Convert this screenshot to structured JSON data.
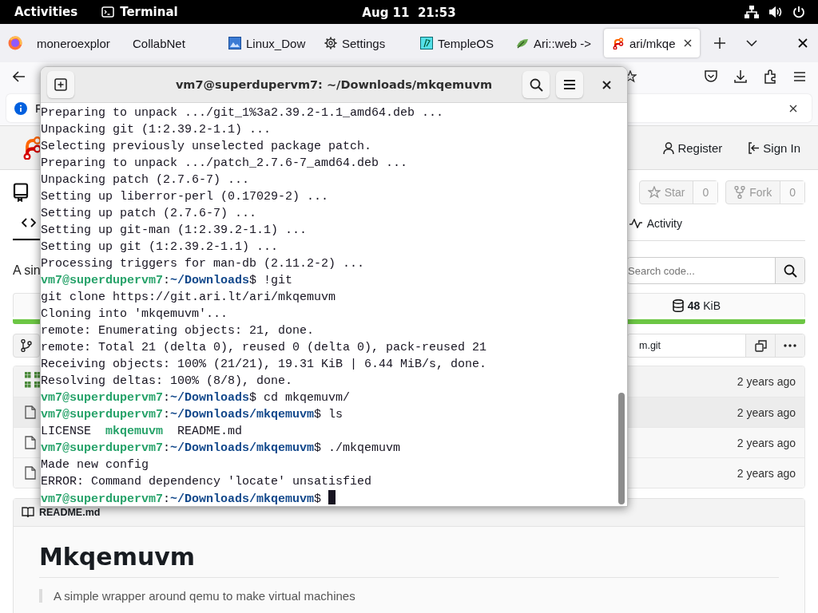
{
  "top_bar": {
    "activities": "Activities",
    "app": "Terminal",
    "clock": "Aug 11  21:53"
  },
  "browser": {
    "tabs": [
      {
        "label": "moneroexplor",
        "kind": "plain",
        "selected": false
      },
      {
        "label": "CollabNet",
        "kind": "plain",
        "selected": false
      },
      {
        "label": "Linux_Dow",
        "kind": "image",
        "selected": false
      },
      {
        "label": "Settings",
        "kind": "gear",
        "selected": false
      },
      {
        "label": "TempleOS",
        "kind": "page",
        "selected": false
      },
      {
        "label": "Ari::web ->",
        "kind": "leaf",
        "selected": false
      },
      {
        "label": "ari/mkqe",
        "kind": "forge",
        "selected": true
      }
    ],
    "info_bar": {
      "text": "F"
    }
  },
  "site_header": {
    "register": "Register",
    "sign_in": "Sign In"
  },
  "repo": {
    "star": "Star",
    "star_count": "0",
    "fork": "Fork",
    "fork_count": "0",
    "tabs": [
      {
        "kind": "code",
        "selected": true
      },
      {
        "kind": "activity",
        "label": "Activity",
        "selected": false
      }
    ],
    "description": "A sin",
    "search_placeholder": "Search code...",
    "size": "**48** KiB",
    "clone_url": "m.git",
    "files": [
      {
        "kind": "commit",
        "time": "2 years ago",
        "highlighted": false
      },
      {
        "kind": "file",
        "time": "2 years ago",
        "highlighted": true
      },
      {
        "kind": "file",
        "time": "2 years ago",
        "highlighted": false
      },
      {
        "kind": "file",
        "time": "2 years ago",
        "highlighted": false
      }
    ],
    "readme": {
      "file": "README.md",
      "title": "Mkqemuvm",
      "quote": "A simple wrapper around qemu to make virtual machines"
    }
  },
  "terminal": {
    "title": "vm7@superdupervm7: ~/Downloads/mkqemuvm",
    "lines": [
      {
        "cursor": false,
        "segments": [
          {
            "kind": "plain",
            "text": "Preparing to unpack .../git_1%3a2.39.2-1.1_amd64.deb ..."
          }
        ]
      },
      {
        "cursor": false,
        "segments": [
          {
            "kind": "plain",
            "text": "Unpacking git (1:2.39.2-1.1) ..."
          }
        ]
      },
      {
        "cursor": false,
        "segments": [
          {
            "kind": "plain",
            "text": "Selecting previously unselected package patch."
          }
        ]
      },
      {
        "cursor": false,
        "segments": [
          {
            "kind": "plain",
            "text": "Preparing to unpack .../patch_2.7.6-7_amd64.deb ..."
          }
        ]
      },
      {
        "cursor": false,
        "segments": [
          {
            "kind": "plain",
            "text": "Unpacking patch (2.7.6-7) ..."
          }
        ]
      },
      {
        "cursor": false,
        "segments": [
          {
            "kind": "plain",
            "text": "Setting up liberror-perl (0.17029-2) ..."
          }
        ]
      },
      {
        "cursor": false,
        "segments": [
          {
            "kind": "plain",
            "text": "Setting up patch (2.7.6-7) ..."
          }
        ]
      },
      {
        "cursor": false,
        "segments": [
          {
            "kind": "plain",
            "text": "Setting up git-man (1:2.39.2-1.1) ..."
          }
        ]
      },
      {
        "cursor": false,
        "segments": [
          {
            "kind": "plain",
            "text": "Setting up git (1:2.39.2-1.1) ..."
          }
        ]
      },
      {
        "cursor": false,
        "segments": [
          {
            "kind": "plain",
            "text": "Processing triggers for man-db (2.11.2-2) ..."
          }
        ]
      },
      {
        "cursor": false,
        "segments": [
          {
            "kind": "user",
            "text": "vm7@superdupervm7"
          },
          {
            "kind": "plain",
            "text": ":"
          },
          {
            "kind": "path",
            "text": "~/Downloads"
          },
          {
            "kind": "plain",
            "text": "$ !git"
          }
        ]
      },
      {
        "cursor": false,
        "segments": [
          {
            "kind": "plain",
            "text": "git clone https://git.ari.lt/ari/mkqemuvm"
          }
        ]
      },
      {
        "cursor": false,
        "segments": [
          {
            "kind": "plain",
            "text": "Cloning into 'mkqemuvm'..."
          }
        ]
      },
      {
        "cursor": false,
        "segments": [
          {
            "kind": "plain",
            "text": "remote: Enumerating objects: 21, done."
          }
        ]
      },
      {
        "cursor": false,
        "segments": [
          {
            "kind": "plain",
            "text": "remote: Total 21 (delta 0), reused 0 (delta 0), pack-reused 21"
          }
        ]
      },
      {
        "cursor": false,
        "segments": [
          {
            "kind": "plain",
            "text": "Receiving objects: 100% (21/21), 19.31 KiB | 6.44 MiB/s, done."
          }
        ]
      },
      {
        "cursor": false,
        "segments": [
          {
            "kind": "plain",
            "text": "Resolving deltas: 100% (8/8), done."
          }
        ]
      },
      {
        "cursor": false,
        "segments": [
          {
            "kind": "user",
            "text": "vm7@superdupervm7"
          },
          {
            "kind": "plain",
            "text": ":"
          },
          {
            "kind": "path",
            "text": "~/Downloads"
          },
          {
            "kind": "plain",
            "text": "$ cd mkqemuvm/"
          }
        ]
      },
      {
        "cursor": false,
        "segments": [
          {
            "kind": "user",
            "text": "vm7@superdupervm7"
          },
          {
            "kind": "plain",
            "text": ":"
          },
          {
            "kind": "path",
            "text": "~/Downloads/mkqemuvm"
          },
          {
            "kind": "plain",
            "text": "$ ls"
          }
        ]
      },
      {
        "cursor": false,
        "segments": [
          {
            "kind": "plain",
            "text": "LICENSE  "
          },
          {
            "kind": "exec",
            "text": "mkqemuvm"
          },
          {
            "kind": "plain",
            "text": "  README.md"
          }
        ]
      },
      {
        "cursor": false,
        "segments": [
          {
            "kind": "user",
            "text": "vm7@superdupervm7"
          },
          {
            "kind": "plain",
            "text": ":"
          },
          {
            "kind": "path",
            "text": "~/Downloads/mkqemuvm"
          },
          {
            "kind": "plain",
            "text": "$ ./mkqemuvm"
          }
        ]
      },
      {
        "cursor": false,
        "segments": [
          {
            "kind": "plain",
            "text": "Made new config"
          }
        ]
      },
      {
        "cursor": false,
        "segments": [
          {
            "kind": "plain",
            "text": "ERROR: Command dependency 'locate' unsatisfied"
          }
        ]
      },
      {
        "cursor": true,
        "segments": [
          {
            "kind": "user",
            "text": "vm7@superdupervm7"
          },
          {
            "kind": "plain",
            "text": ":"
          },
          {
            "kind": "path",
            "text": "~/Downloads/mkqemuvm"
          },
          {
            "kind": "plain",
            "text": "$ "
          }
        ]
      }
    ]
  }
}
